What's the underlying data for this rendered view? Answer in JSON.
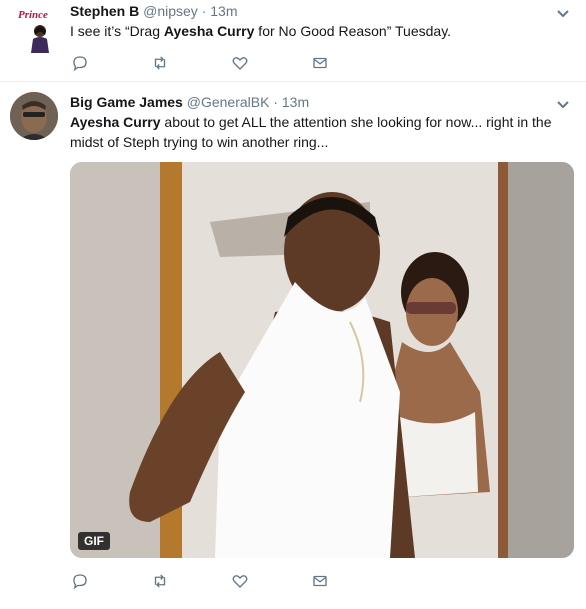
{
  "tweets": [
    {
      "fullname": "Stephen B",
      "username": "@nipsey",
      "dot": "·",
      "time": "13m",
      "avatar_text": "Prince",
      "text_before": "I see it’s “Drag ",
      "text_bold": "Ayesha Curry",
      "text_after": " for No Good Reason” Tuesday."
    },
    {
      "fullname": "Big Game James",
      "username": "@GeneralBK",
      "dot": "·",
      "time": "13m",
      "text_bold": "Ayesha Curry",
      "text_after": " about to get ALL the attention she looking for now... right in the midst of Steph trying to win another ring...",
      "media_badge": "GIF"
    }
  ],
  "icons": [
    "chevron-down-icon",
    "reply-icon",
    "retweet-icon",
    "like-icon",
    "direct-message-icon"
  ],
  "colors": {
    "text_primary": "#14171a",
    "text_secondary": "#657786",
    "border": "#e6ecf0"
  }
}
